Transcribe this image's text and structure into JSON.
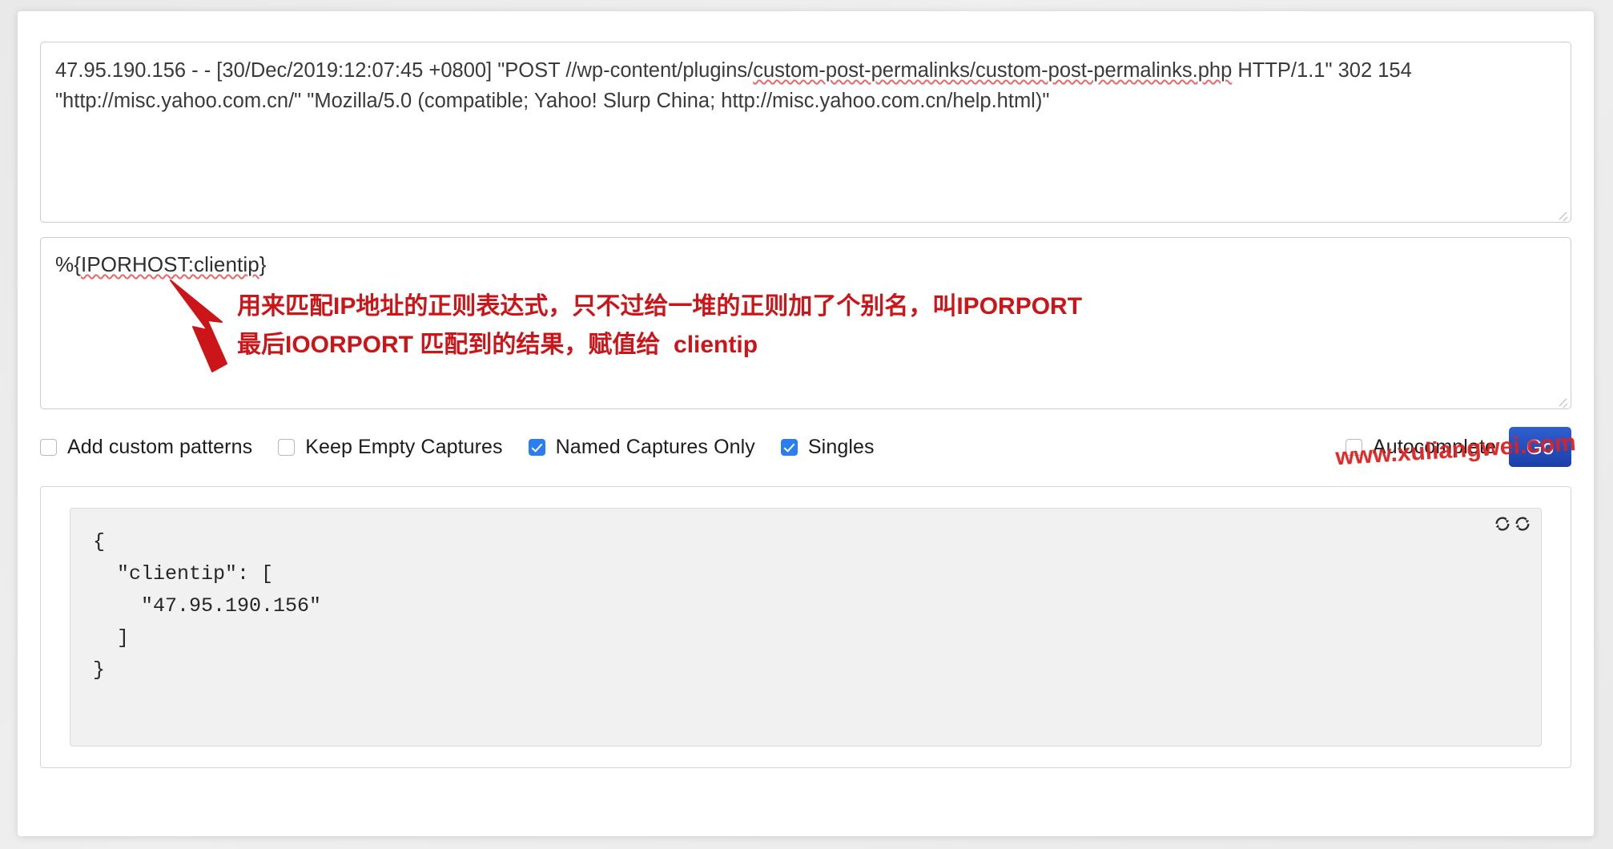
{
  "input": {
    "label": "log-input",
    "value_line1": "47.95.190.156 - - [30/Dec/2019:12:07:45 +0800] \"POST //wp-content/plugins/",
    "value_misspelled1": "custom-post-permalinks/custom-post-permalinks.php",
    "value_line1_tail": " HTTP/1.1\" 302",
    "value_line2": "154 \"http://misc.yahoo.com.cn/\" \"Mozilla/5.0 (compatible; Yahoo! Slurp China; http://misc.yahoo.com.cn/help.html)\"",
    "full_value": "47.95.190.156 - - [30/Dec/2019:12:07:45 +0800] \"POST //wp-content/plugins/custom-post-permalinks/custom-post-permalinks.php HTTP/1.1\" 302 154 \"http://misc.yahoo.com.cn/\" \"Mozilla/5.0 (compatible; Yahoo! Slurp China; http://misc.yahoo.com.cn/help.html)\"",
    "placeholder": ""
  },
  "pattern": {
    "prefix": "%{",
    "misspelled": "IPORHOST:clientip",
    "suffix": "}",
    "full_value": "%{IPORHOST:clientip}",
    "placeholder": ""
  },
  "annotation": {
    "line1": "用来匹配IP地址的正则表达式，只不过给一堆的正则加了个别名，叫IPORPORT",
    "line2": "最后IOORPORT 匹配到的结果，赋值给  clientip",
    "color": "#cc1518",
    "arrow": "red-arrow-up-left"
  },
  "options": [
    {
      "label": "Add custom patterns",
      "checked": false,
      "name": "add-custom-patterns"
    },
    {
      "label": "Keep Empty Captures",
      "checked": false,
      "name": "keep-empty-captures"
    },
    {
      "label": "Named Captures Only",
      "checked": true,
      "name": "named-captures-only"
    },
    {
      "label": "Singles",
      "checked": true,
      "name": "singles"
    }
  ],
  "autocomplete": {
    "label": "Autocomplete",
    "checked": false
  },
  "go_button": {
    "label": "Go",
    "color": "#1c3fa8"
  },
  "watermark": {
    "text": "www.xuliangwei.com",
    "color": "#e02020"
  },
  "results": {
    "json": "{\n  \"clientip\": [\n    \"47.95.190.156\"\n  ]\n}",
    "refresh_icon_1": "refresh-cycle-icon",
    "refresh_icon_2": "refresh-cycle-icon"
  }
}
